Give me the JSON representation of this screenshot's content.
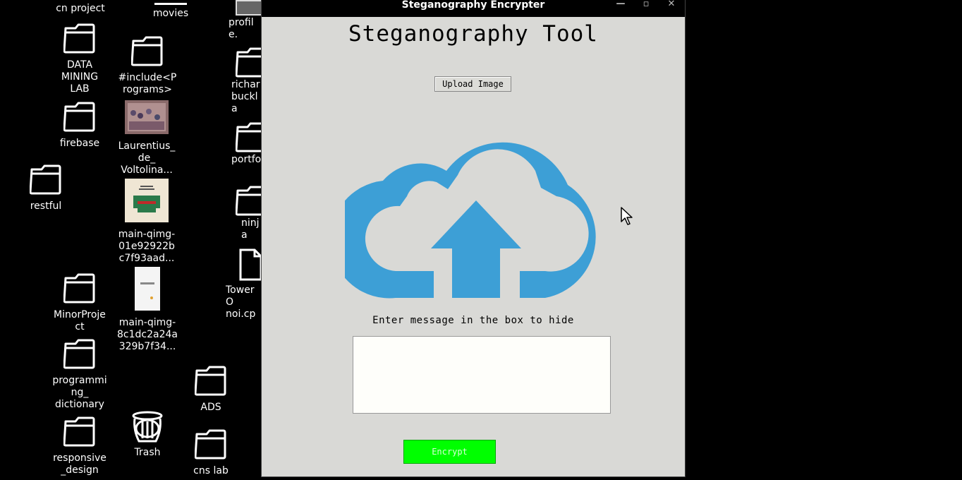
{
  "desktop": {
    "icons": [
      {
        "label": "cn project"
      },
      {
        "label": "movies"
      },
      {
        "label": "profile."
      },
      {
        "label": "DATA\nMINING\nLAB"
      },
      {
        "label": "#include<P\nrograms>"
      },
      {
        "label": "richar\nbuckla"
      },
      {
        "label": "firebase"
      },
      {
        "label": "Laurentius_\nde_\nVoltolina..."
      },
      {
        "label": "portfo"
      },
      {
        "label": "restful"
      },
      {
        "label": "main-qimg-\n01e92922b\nc7f93aad..."
      },
      {
        "label": "ninja"
      },
      {
        "label": "TowerO\nnoi.cp"
      },
      {
        "label": "MinorProje\nct"
      },
      {
        "label": "main-qimg-\n8c1dc2a24a\n329b7f34..."
      },
      {
        "label": "programmi\nng_\ndictionary"
      },
      {
        "label": "ADS"
      },
      {
        "label": "responsive\n_design"
      },
      {
        "label": "Trash"
      },
      {
        "label": "cns lab"
      }
    ]
  },
  "window": {
    "title": "Steganography Encrypter",
    "minimize": "—",
    "maximize": "▫",
    "close": "✕"
  },
  "app": {
    "heading": "Steganography Tool",
    "upload_label": "Upload Image",
    "cloud_color": "#3d9fd6",
    "message_label": "Enter message in the box to hide",
    "message_value": "",
    "encrypt_label": "Encrypt",
    "encrypt_color": "#00ff00"
  }
}
